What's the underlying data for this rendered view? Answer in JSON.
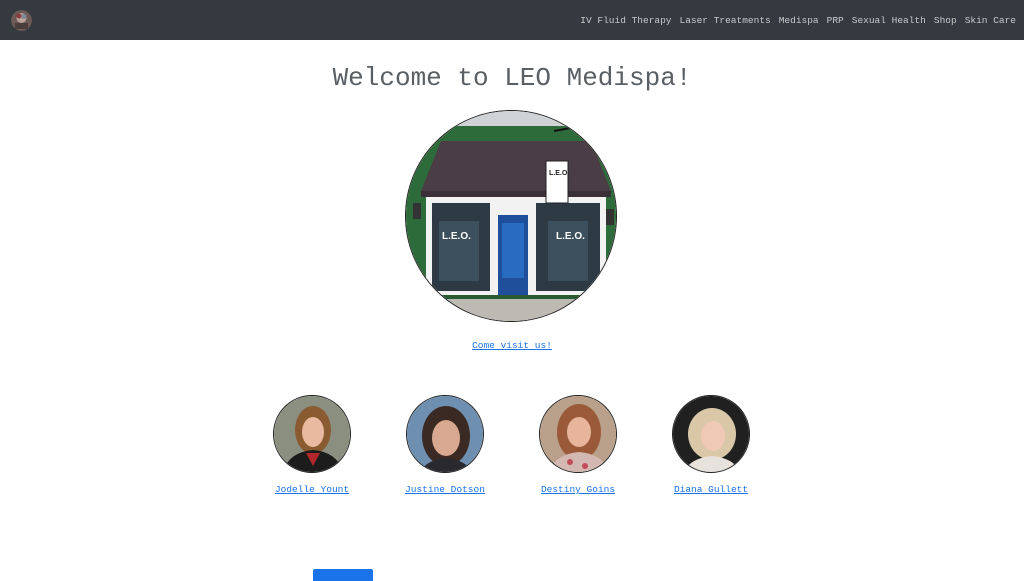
{
  "navbar": {
    "links": [
      "IV Fluid Therapy",
      "Laser Treatments",
      "Medispa",
      "PRP",
      "Sexual Health",
      "Shop",
      "Skin Care"
    ]
  },
  "main": {
    "title": "Welcome to LEO Medispa!",
    "visit_link": "Come visit us!",
    "store_sign": "L.E.O."
  },
  "staff": [
    {
      "name": "Jodelle Yount"
    },
    {
      "name": "Justine Dotson"
    },
    {
      "name": "Destiny Goins"
    },
    {
      "name": "Diana Gullett"
    }
  ],
  "colors": {
    "navbar_bg": "#343a40",
    "link": "#1a73e8",
    "title": "#5a5f64",
    "storefront_green": "#1f5a2e"
  }
}
